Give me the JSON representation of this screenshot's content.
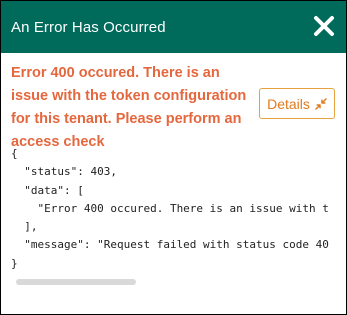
{
  "dialog": {
    "title": "An Error Has Occurred",
    "close_icon": "close-icon",
    "message": "Error 400 occured. There is an issue with the token configuration for this tenant. Please perform an access check",
    "details_button": {
      "label": "Details",
      "icon": "collapse-arrows-icon"
    },
    "response_lines": [
      "{",
      "  \"status\": 403,",
      "  \"data\": [",
      "    \"Error 400 occured. There is an issue with t",
      "  ],",
      "  \"message\": \"Request failed with status code 40",
      "}"
    ]
  },
  "colors": {
    "header_bg": "#006a5b",
    "error_text": "#e5673d",
    "details_border": "#e5a23d",
    "details_text": "#e07b1f"
  }
}
